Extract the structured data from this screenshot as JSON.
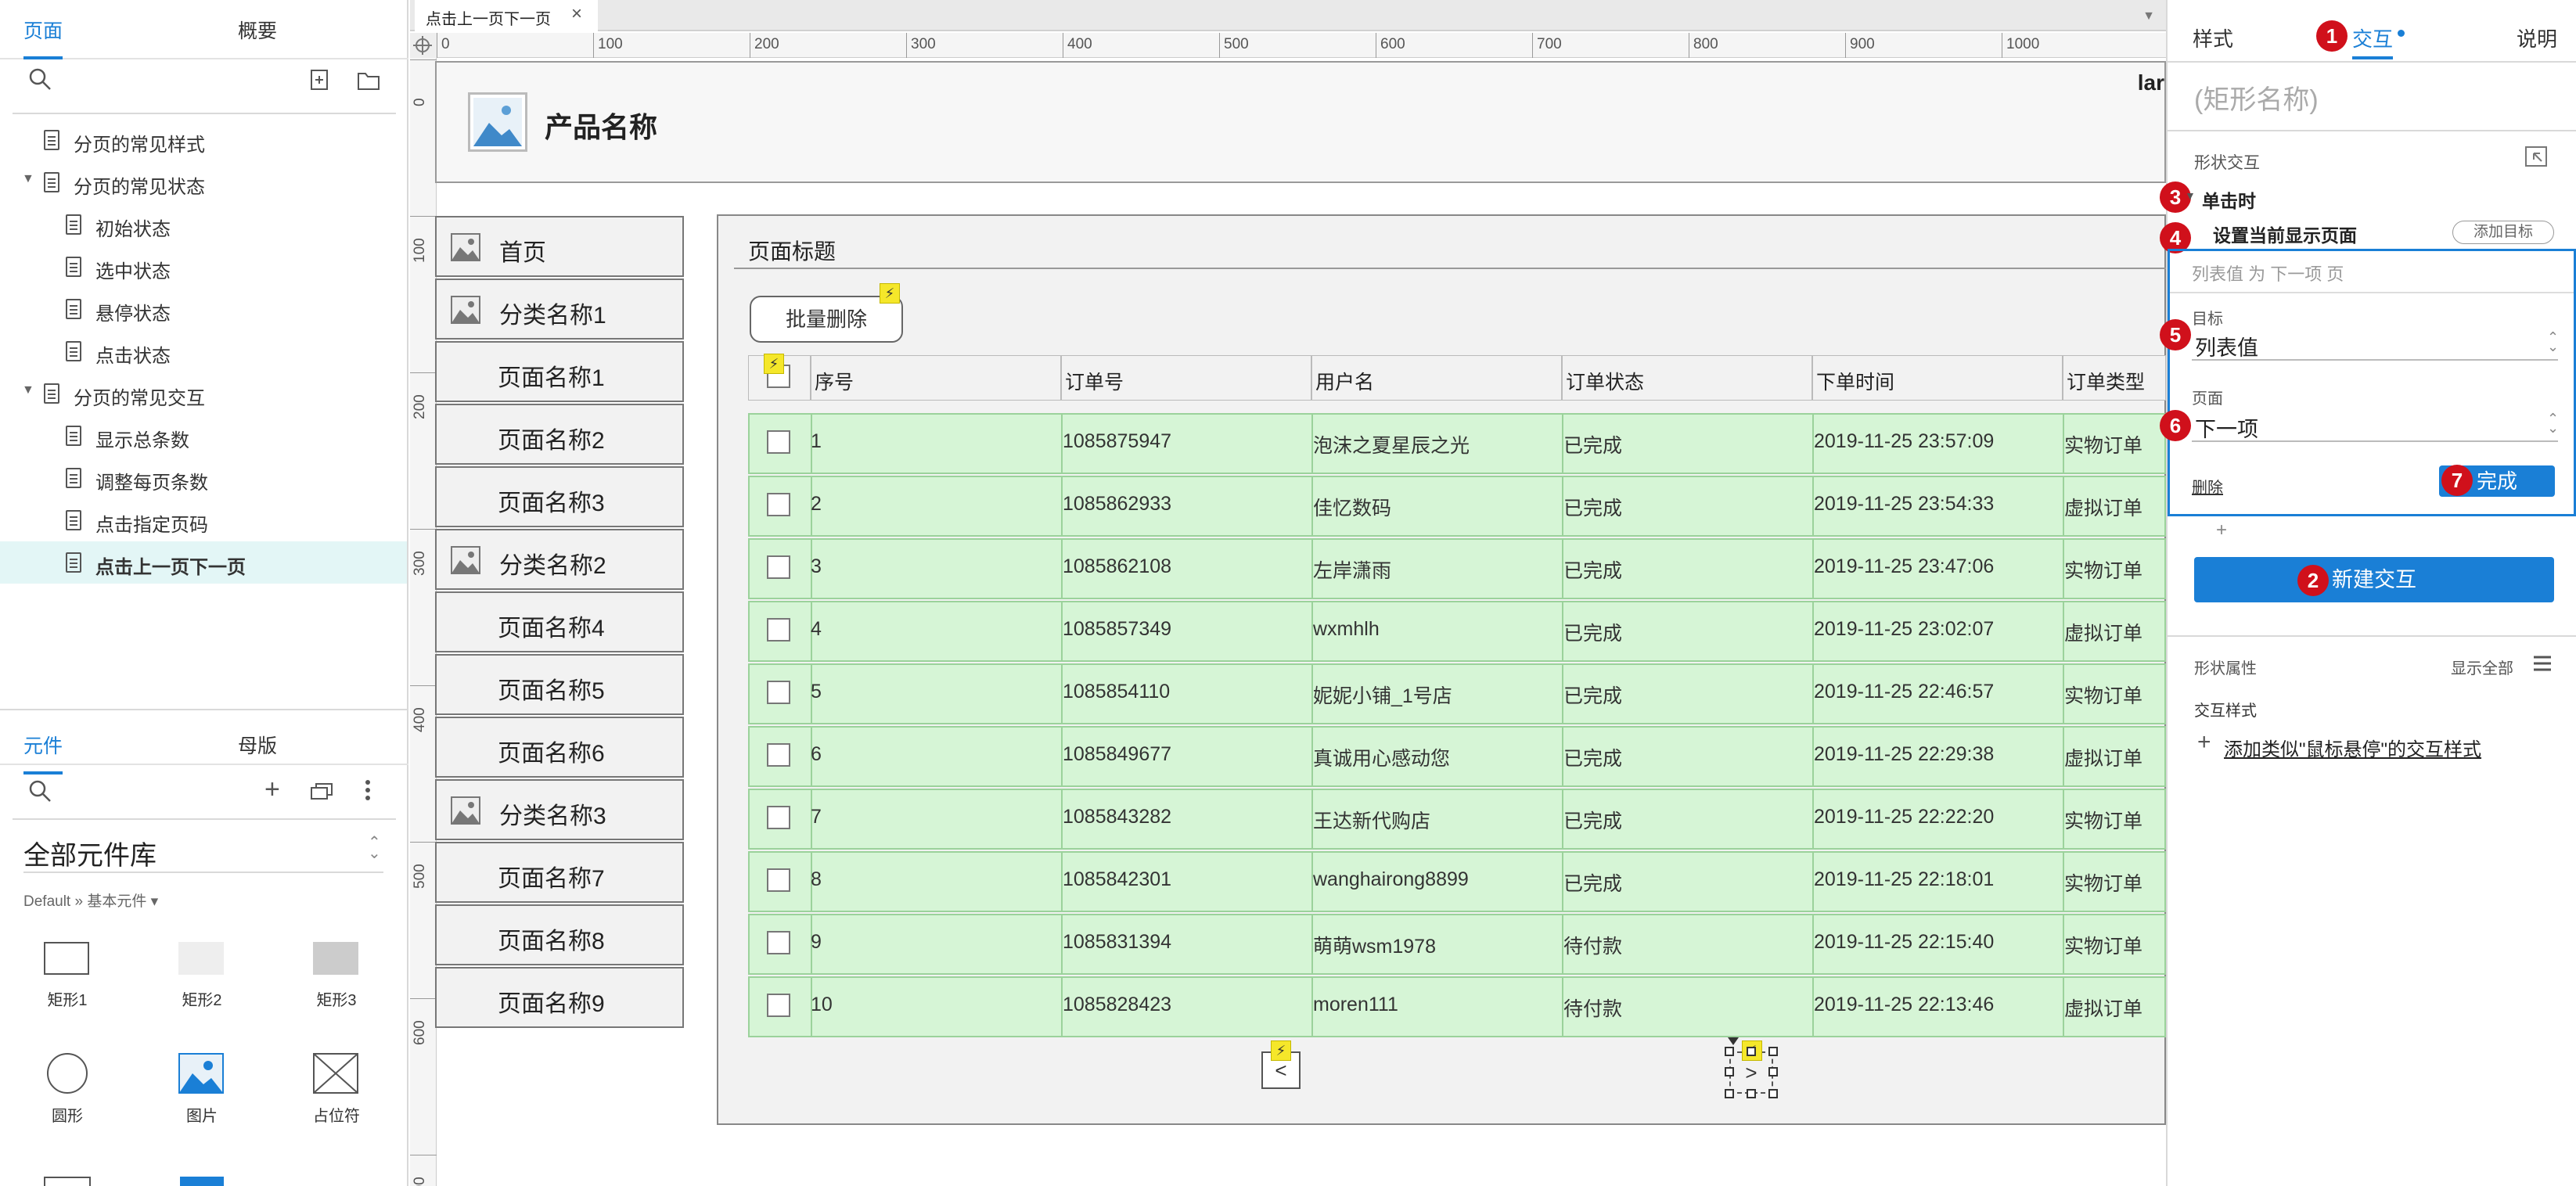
{
  "left_panel": {
    "tabs": [
      "页面",
      "概要"
    ],
    "tree": [
      {
        "label": "分页的常见样式",
        "level": 0,
        "arrow": false
      },
      {
        "label": "分页的常见状态",
        "level": 0,
        "arrow": true
      },
      {
        "label": "初始状态",
        "level": 1,
        "arrow": false
      },
      {
        "label": "选中状态",
        "level": 1,
        "arrow": false
      },
      {
        "label": "悬停状态",
        "level": 1,
        "arrow": false
      },
      {
        "label": "点击状态",
        "level": 1,
        "arrow": false
      },
      {
        "label": "分页的常见交互",
        "level": 0,
        "arrow": true
      },
      {
        "label": "显示总条数",
        "level": 1,
        "arrow": false
      },
      {
        "label": "调整每页条数",
        "level": 1,
        "arrow": false
      },
      {
        "label": "点击指定页码",
        "level": 1,
        "arrow": false
      },
      {
        "label": "点击上一页下一页",
        "level": 1,
        "arrow": false,
        "selected": true
      }
    ],
    "lib_tabs": [
      "元件",
      "母版"
    ],
    "library_title": "全部元件库",
    "library_sub": "Default » 基本元件 ▾",
    "widgets": [
      "矩形1",
      "矩形2",
      "矩形3",
      "圆形",
      "图片",
      "占位符"
    ]
  },
  "canvas": {
    "doc_tab": "点击上一页下一页",
    "ruler_h": [
      "0",
      "100",
      "200",
      "300",
      "400",
      "500",
      "600",
      "700",
      "800",
      "900",
      "1000"
    ],
    "ruler_v": [
      "0",
      "100",
      "200",
      "300",
      "400",
      "500",
      "600",
      "700"
    ],
    "cut_text": "lar",
    "product_name": "产品名称",
    "nav": [
      {
        "label": "首页",
        "icon": true
      },
      {
        "label": "分类名称1",
        "icon": true
      },
      {
        "label": "页面名称1",
        "icon": false
      },
      {
        "label": "页面名称2",
        "icon": false
      },
      {
        "label": "页面名称3",
        "icon": false
      },
      {
        "label": "分类名称2",
        "icon": true
      },
      {
        "label": "页面名称4",
        "icon": false
      },
      {
        "label": "页面名称5",
        "icon": false
      },
      {
        "label": "页面名称6",
        "icon": false
      },
      {
        "label": "分类名称3",
        "icon": true
      },
      {
        "label": "页面名称7",
        "icon": false
      },
      {
        "label": "页面名称8",
        "icon": false
      },
      {
        "label": "页面名称9",
        "icon": false
      }
    ],
    "page_title": "页面标题",
    "batch_delete": "批量删除",
    "columns": [
      "序号",
      "订单号",
      "用户名",
      "订单状态",
      "下单时间",
      "订单类型"
    ],
    "rows": [
      [
        "1",
        "1085875947",
        "泡沫之夏星辰之光",
        "已完成",
        "2019-11-25 23:57:09",
        "实物订单"
      ],
      [
        "2",
        "1085862933",
        "佳忆数码",
        "已完成",
        "2019-11-25 23:54:33",
        "虚拟订单"
      ],
      [
        "3",
        "1085862108",
        "左岸潇雨",
        "已完成",
        "2019-11-25 23:47:06",
        "实物订单"
      ],
      [
        "4",
        "1085857349",
        "wxmhlh",
        "已完成",
        "2019-11-25 23:02:07",
        "虚拟订单"
      ],
      [
        "5",
        "1085854110",
        "妮妮小铺_1号店",
        "已完成",
        "2019-11-25 22:46:57",
        "实物订单"
      ],
      [
        "6",
        "1085849677",
        "真诚用心感动您",
        "已完成",
        "2019-11-25 22:29:38",
        "虚拟订单"
      ],
      [
        "7",
        "1085843282",
        "王达新代购店",
        "已完成",
        "2019-11-25 22:22:20",
        "实物订单"
      ],
      [
        "8",
        "1085842301",
        "wanghairong8899",
        "已完成",
        "2019-11-25 22:18:01",
        "实物订单"
      ],
      [
        "9",
        "1085831394",
        "萌萌wsm1978",
        "待付款",
        "2019-11-25 22:15:40",
        "实物订单"
      ],
      [
        "10",
        "1085828423",
        "moren111",
        "待付款",
        "2019-11-25 22:13:46",
        "虚拟订单"
      ]
    ],
    "prev_label": "<",
    "next_label": ">"
  },
  "right_panel": {
    "tabs": [
      "样式",
      "交互",
      "说明"
    ],
    "shape_name": "(矩形名称)",
    "shape_interaction": "形状交互",
    "on_click": "单击时",
    "action": "设置当前显示页面",
    "add_target": "添加目标",
    "summary": "列表值 为 下一项 页",
    "target_label": "目标",
    "target_value": "列表值",
    "page_label": "页面",
    "page_value": "下一项",
    "delete": "删除",
    "done": "完成",
    "new_interaction": "新建交互",
    "shape_props": "形状属性",
    "show_all": "显示全部",
    "interaction_style": "交互样式",
    "add_style": "添加类似\"鼠标悬停\"的交互样式",
    "badges": [
      "1",
      "2",
      "3",
      "4",
      "5",
      "6",
      "7"
    ],
    "accent": "#1a7fd6",
    "badge_color": "#d0101b"
  }
}
